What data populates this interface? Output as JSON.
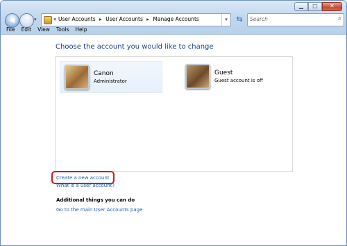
{
  "window": {
    "buttons": {
      "minimize": "▁",
      "maximize": "□",
      "close": "✕"
    }
  },
  "navigation": {
    "back_icon": "arrow-left-icon",
    "forward_icon": "arrow-right-icon",
    "recent_pages_dropdown": "▾",
    "breadcrumb_prefix": "«",
    "breadcrumb": [
      "User Accounts",
      "User Accounts",
      "Manage Accounts"
    ],
    "breadcrumb_separator": "▸",
    "address_dropdown": "▾",
    "refresh_icon": "⇆"
  },
  "search": {
    "placeholder": "Search"
  },
  "menu": [
    "File",
    "Edit",
    "View",
    "Tools",
    "Help"
  ],
  "main": {
    "title": "Choose the account you would like to change",
    "accounts": [
      {
        "name": "Canon",
        "type": "Administrator",
        "icon": "user-picture-icon"
      },
      {
        "name": "Guest",
        "type": "Guest account is off",
        "icon": "user-picture-icon"
      }
    ],
    "create_account_link": "Create a new account",
    "what_is_link": "What is a user account?",
    "additional_heading": "Additional things you can do",
    "main_page_link": "Go to the main User Accounts page"
  },
  "colors": {
    "title_blue": "#1e3d8c",
    "link_blue": "#1a5fb4",
    "highlight_red": "#d81818"
  }
}
